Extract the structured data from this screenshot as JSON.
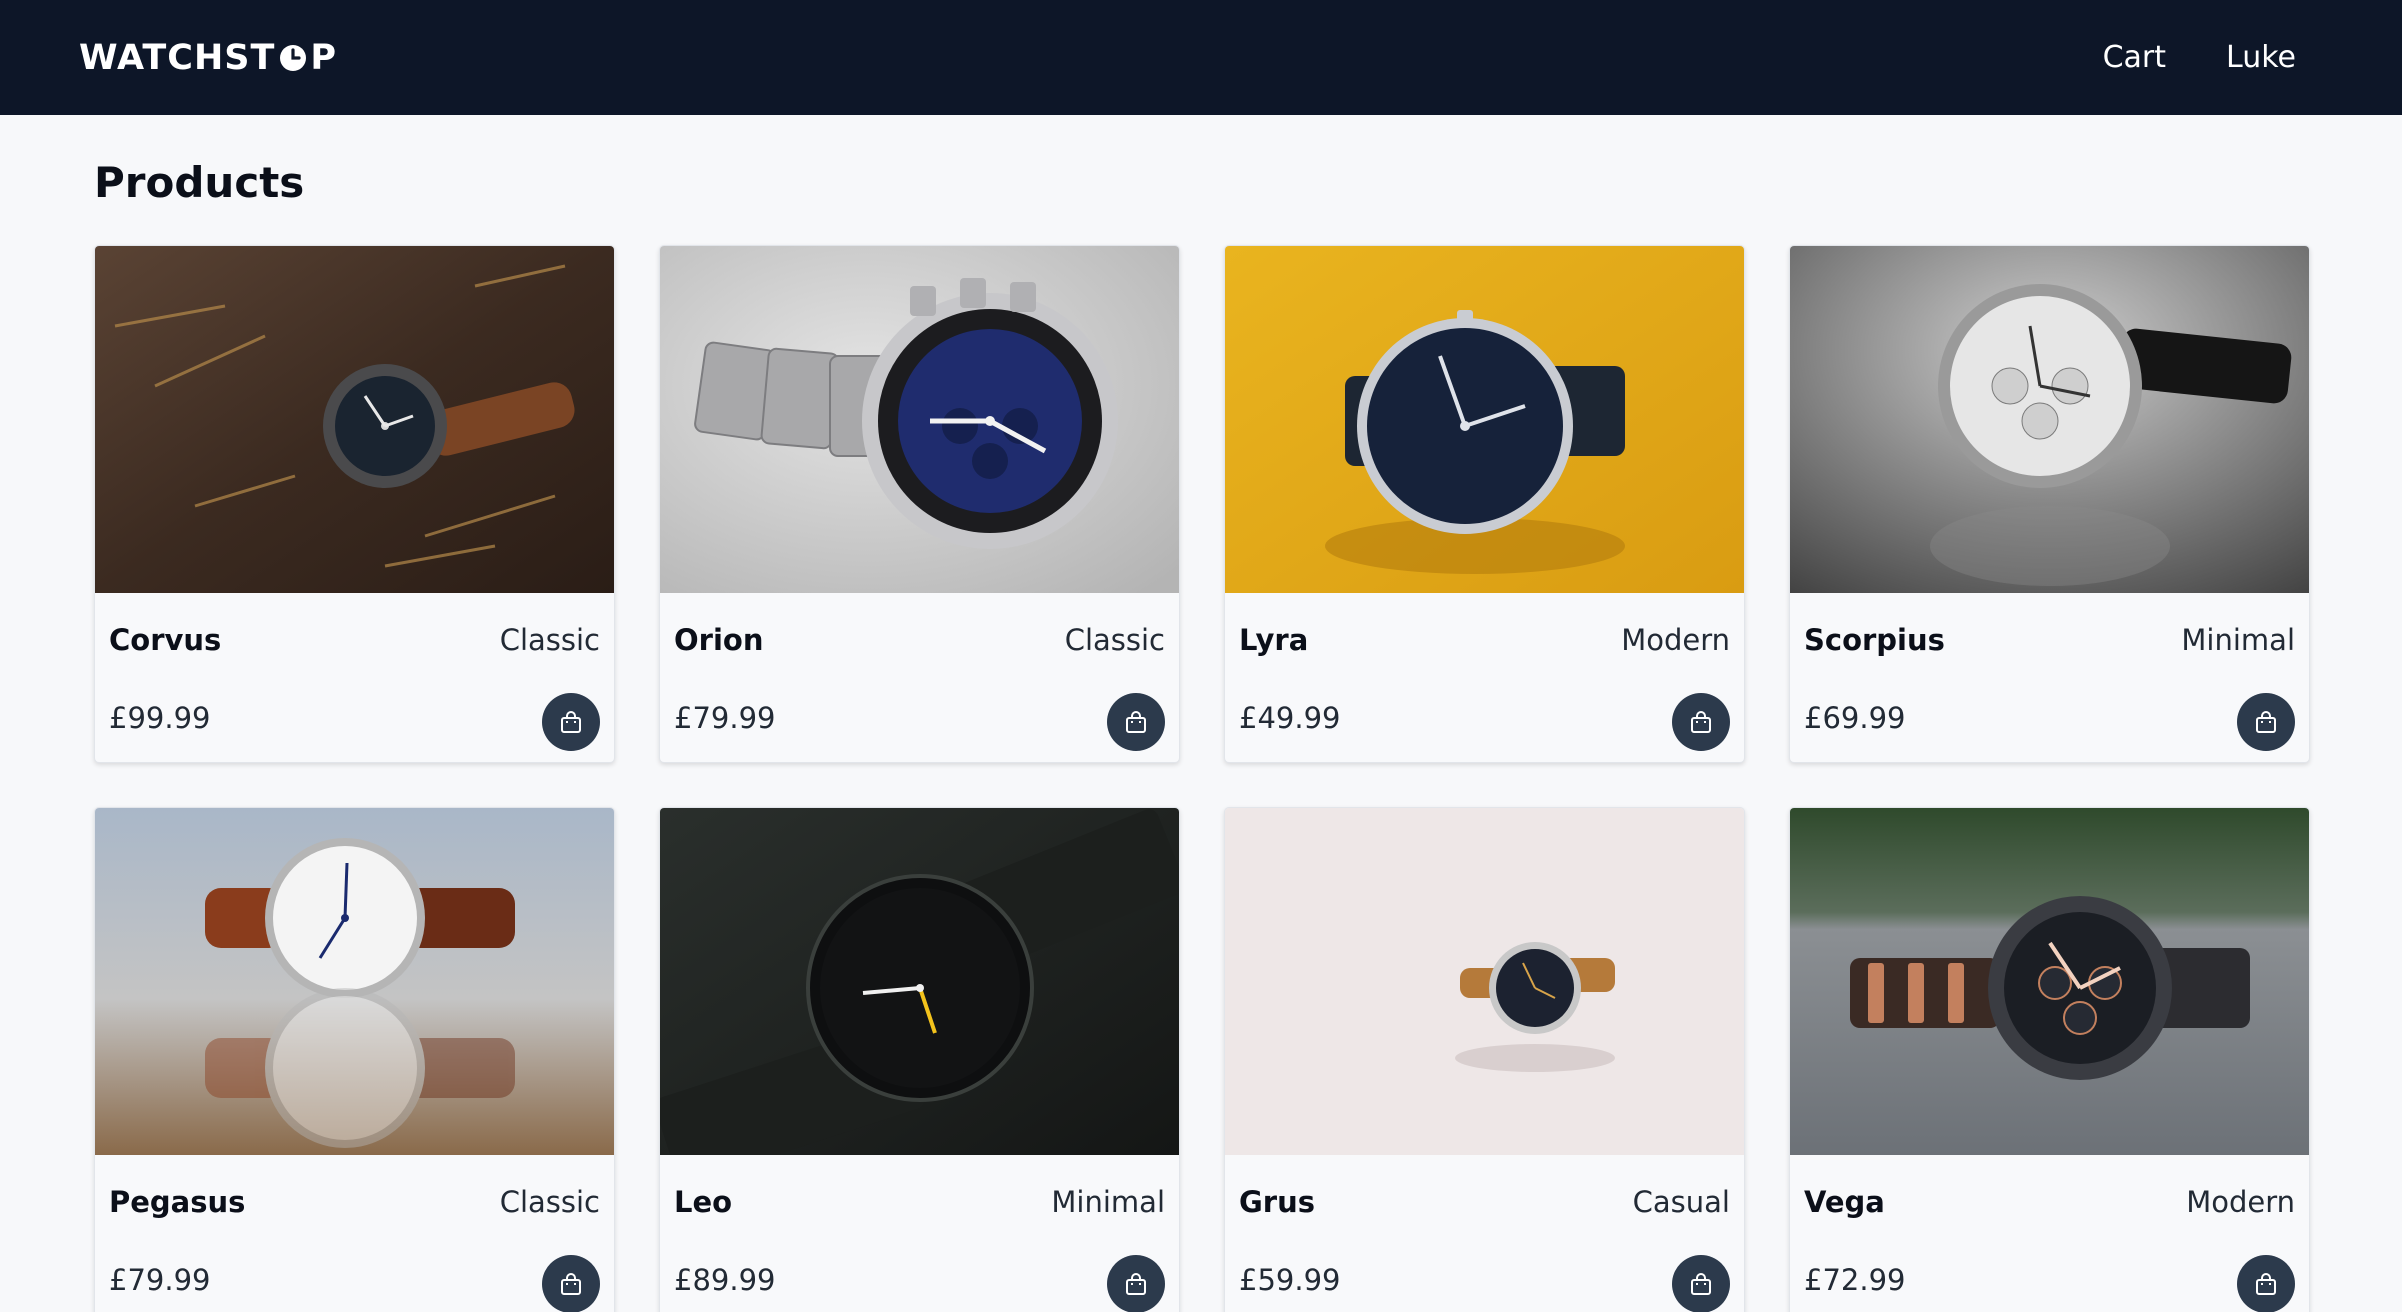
{
  "header": {
    "brand_prefix": "WATCHST",
    "brand_suffix": "P",
    "nav": [
      "Cart",
      "Luke"
    ]
  },
  "page": {
    "title": "Products"
  },
  "products": [
    {
      "name": "Corvus",
      "category": "Classic",
      "price": "£99.99",
      "image_icon": "watch-photo-dark-wood"
    },
    {
      "name": "Orion",
      "category": "Classic",
      "price": "£79.99",
      "image_icon": "watch-photo-steel-chronograph"
    },
    {
      "name": "Lyra",
      "category": "Modern",
      "price": "£49.99",
      "image_icon": "watch-photo-yellow-background"
    },
    {
      "name": "Scorpius",
      "category": "Minimal",
      "price": "£69.99",
      "image_icon": "watch-photo-monochrome"
    },
    {
      "name": "Pegasus",
      "category": "Classic",
      "price": "£79.99",
      "image_icon": "watch-photo-reflection"
    },
    {
      "name": "Leo",
      "category": "Minimal",
      "price": "£89.99",
      "image_icon": "watch-photo-dark-mesh"
    },
    {
      "name": "Grus",
      "category": "Casual",
      "price": "£59.99",
      "image_icon": "watch-photo-pale-background"
    },
    {
      "name": "Vega",
      "category": "Modern",
      "price": "£72.99",
      "image_icon": "watch-photo-stone-surface"
    }
  ],
  "colors": {
    "navbar": "#0d1628",
    "page_bg": "#f7f8fa",
    "cart_button": "#2c3a4c"
  }
}
